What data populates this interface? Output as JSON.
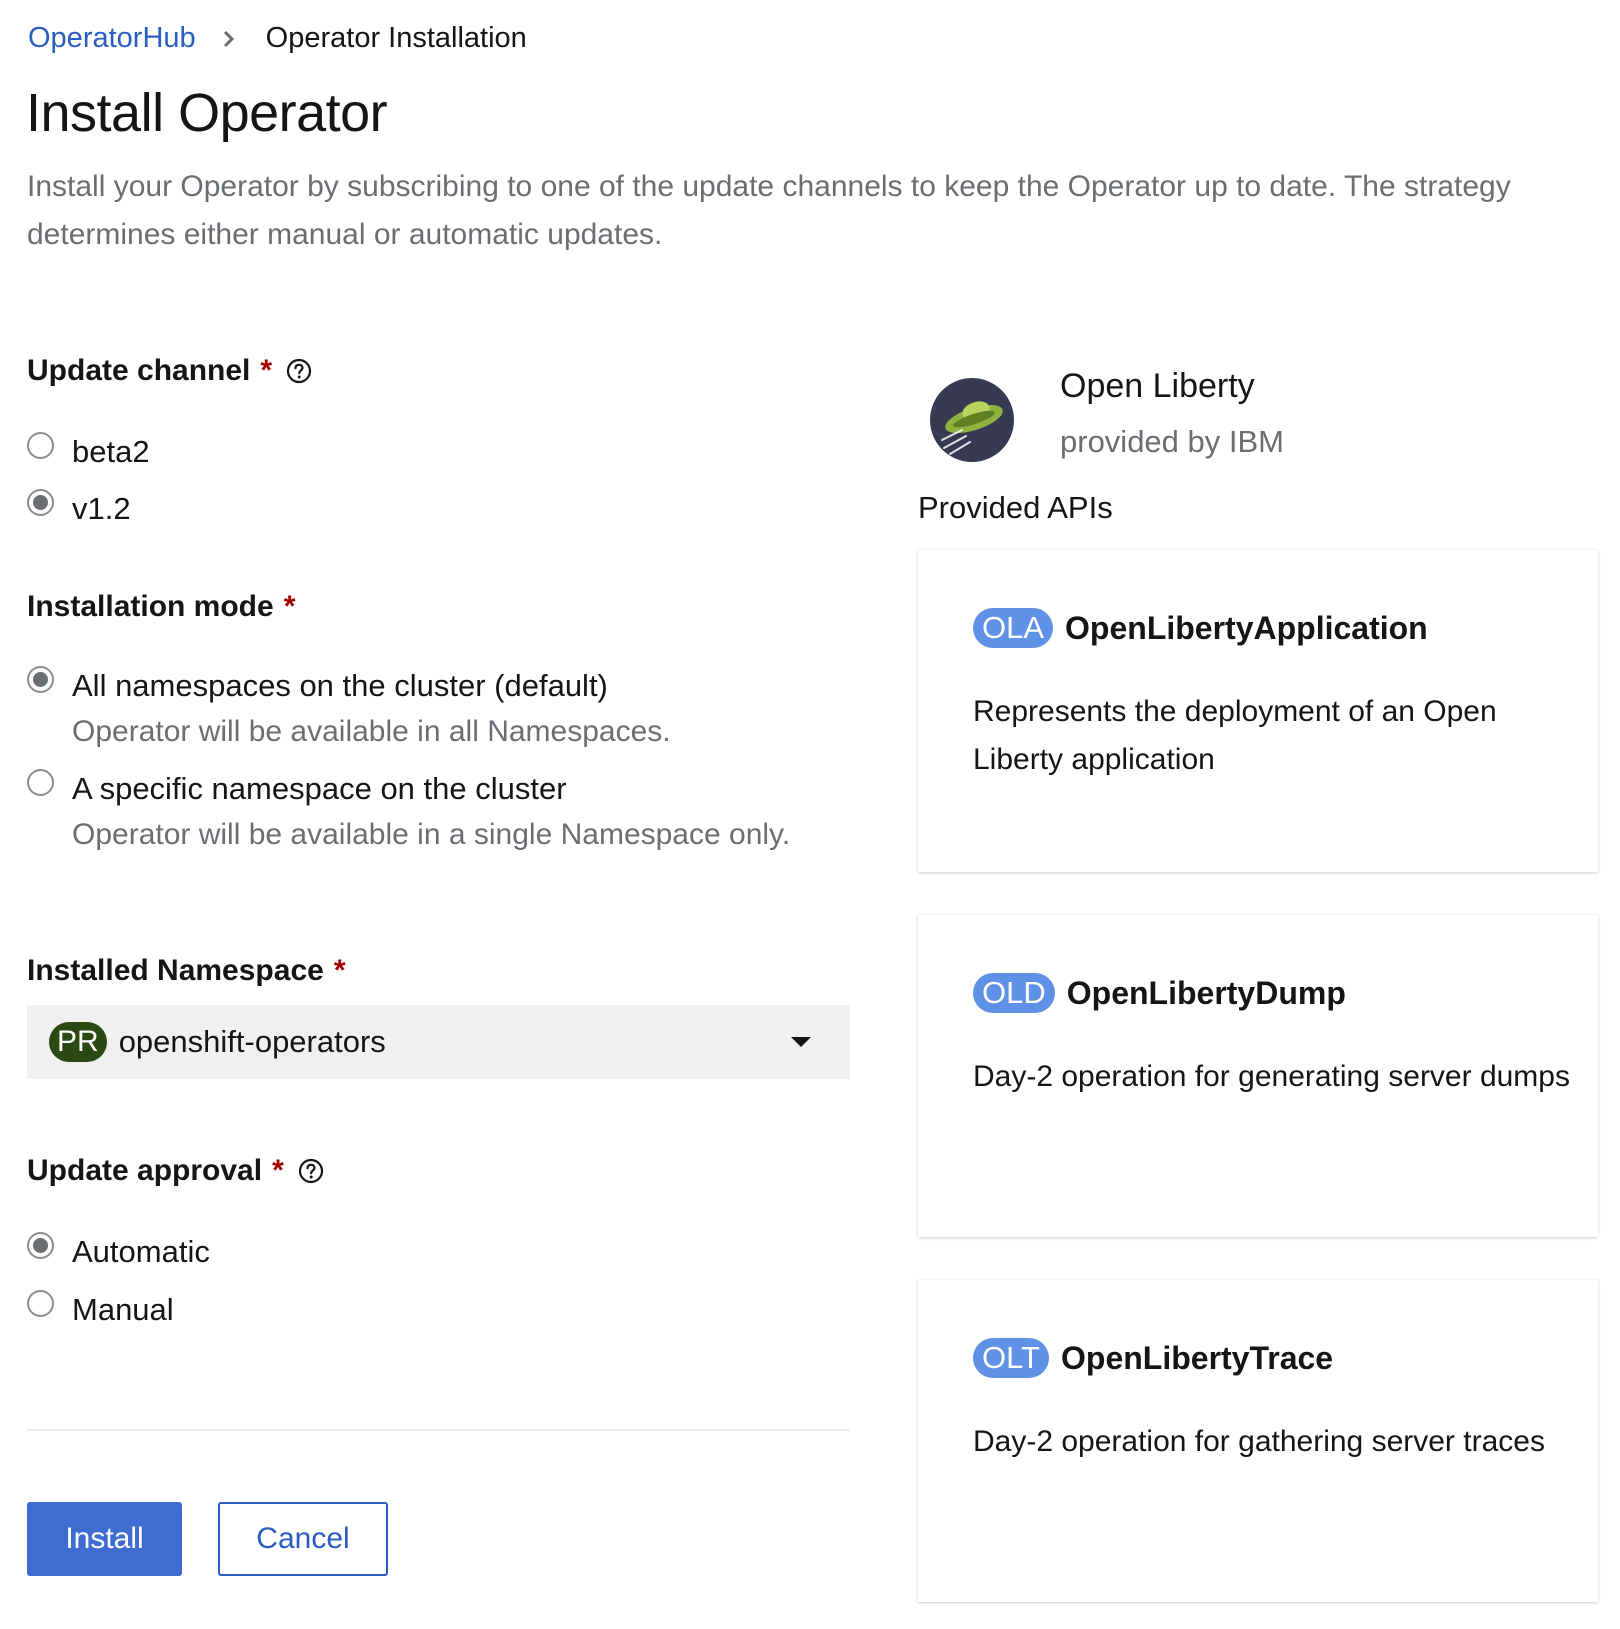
{
  "breadcrumb": {
    "parent": "OperatorHub",
    "current": "Operator Installation"
  },
  "page": {
    "title": "Install Operator",
    "description": "Install your Operator by subscribing to one of the update channels to keep the Operator up to date. The strategy determines either manual or automatic updates."
  },
  "required_marker": "*",
  "update_channel": {
    "label": "Update channel",
    "options": [
      {
        "label": "beta2",
        "selected": false
      },
      {
        "label": "v1.2",
        "selected": true
      }
    ]
  },
  "installation_mode": {
    "label": "Installation mode",
    "options": [
      {
        "label": "All namespaces on the cluster (default)",
        "description": "Operator will be available in all Namespaces.",
        "selected": true
      },
      {
        "label": "A specific namespace on the cluster",
        "description": "Operator will be available in a single Namespace only.",
        "selected": false
      }
    ]
  },
  "installed_namespace": {
    "label": "Installed Namespace",
    "badge": "PR",
    "value": "openshift-operators"
  },
  "update_approval": {
    "label": "Update approval",
    "options": [
      {
        "label": "Automatic",
        "selected": true
      },
      {
        "label": "Manual",
        "selected": false
      }
    ]
  },
  "actions": {
    "install": "Install",
    "cancel": "Cancel"
  },
  "operator": {
    "name": "Open Liberty",
    "provider": "provided by IBM",
    "logo_icon": "open-liberty-ufo-logo"
  },
  "provided_apis": {
    "heading": "Provided APIs",
    "items": [
      {
        "badge": "OLA",
        "name": "OpenLibertyApplication",
        "description": "Represents the deployment of an Open Liberty application"
      },
      {
        "badge": "OLD",
        "name": "OpenLibertyDump",
        "description": "Day-2 operation for generating server dumps"
      },
      {
        "badge": "OLT",
        "name": "OpenLibertyTrace",
        "description": "Day-2 operation for gathering server traces"
      }
    ]
  },
  "colors": {
    "link": "#2b5dc0",
    "primary_button": "#3e6cd0",
    "required": "#a30000",
    "namespace_badge": "#2b4a13",
    "api_badge": "#5f91e6"
  }
}
